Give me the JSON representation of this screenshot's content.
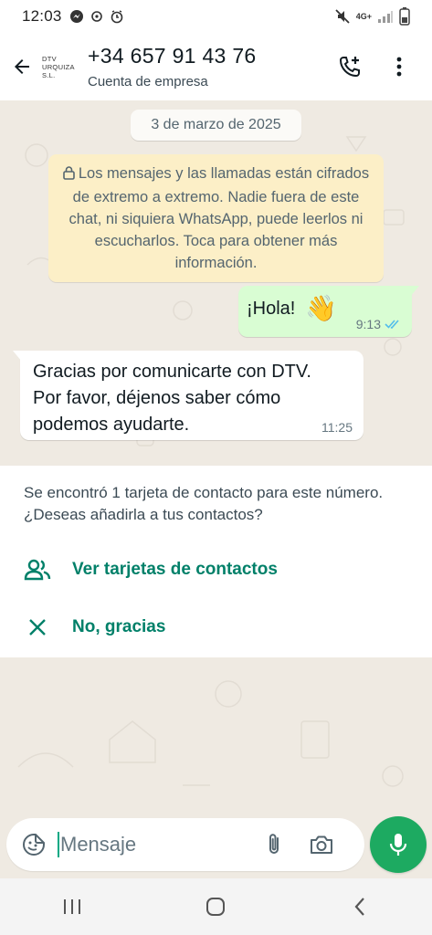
{
  "status_bar": {
    "time": "12:03",
    "network": "4G+"
  },
  "header": {
    "logo_lines": [
      "DTV",
      "URQUIZA",
      "S.L."
    ],
    "title": "+34 657 91 43 76",
    "subtitle": "Cuenta de empresa"
  },
  "chat": {
    "date_chip": "3 de marzo de 2025",
    "encryption_notice": "Los mensajes y las llamadas están cifrados de extremo a extremo. Nadie fuera de este chat, ni siquiera WhatsApp, puede leerlos ni escucharlos. Toca para obtener más información.",
    "messages": [
      {
        "direction": "outgoing",
        "text": "¡Hola!",
        "emoji": "👋",
        "time": "9:13",
        "status": "read"
      },
      {
        "direction": "incoming",
        "text": "Gracias por comunicarte con DTV. Por favor, déjenos saber cómo podemos ayudarte.",
        "time": "11:25"
      }
    ]
  },
  "contact_prompt": {
    "text": "Se encontró 1 tarjeta de contacto para este número. ¿Deseas añadirla a tus contactos?",
    "actions": [
      {
        "label": "Ver tarjetas de contactos",
        "icon": "people-icon"
      },
      {
        "label": "No, gracias",
        "icon": "close-icon"
      }
    ]
  },
  "composer": {
    "placeholder": "Mensaje",
    "value": ""
  },
  "colors": {
    "accent": "#008069",
    "mic_button": "#1daa61",
    "outgoing_bubble": "#d9fdd3",
    "system_note": "#fcefc7",
    "chat_background": "#efeae2",
    "read_ticks": "#53bdeb"
  }
}
